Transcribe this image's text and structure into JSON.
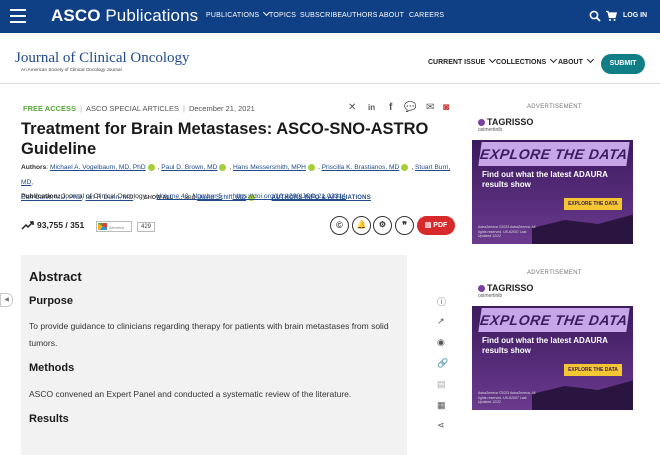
{
  "topbar": {
    "brand_bold": "ASCO",
    "brand_rest": " Publications",
    "nav": [
      "PUBLICATIONS",
      "TOPICS",
      "SUBSCRIBE",
      "AUTHORS",
      "ABOUT",
      "CAREERS"
    ],
    "login": "LOG IN"
  },
  "journal": {
    "title": "Journal of Clinical Oncology",
    "subtitle": "An American Society of Clinical Oncology Journal",
    "nav": [
      "CURRENT ISSUE",
      "COLLECTIONS",
      "ABOUT"
    ],
    "submit": "SUBMIT"
  },
  "article": {
    "access": "FREE ACCESS",
    "section": "ASCO SPECIAL ARTICLES",
    "date": "December 21, 2021",
    "title": "Treatment for Brain Metastases: ASCO-SNO-ASTRO Guideline",
    "authors_label": "Authors",
    "authors": [
      "Michael A. Vogelbaum, MD, PhD",
      "Paul D. Brown, MD",
      "Hans Messersmith, MPH",
      "Priscilla K. Brastianos, MD",
      "Stuart Burri, MD",
      "Dan Cahill, MD, PhD",
      "Ian F. Dunn, MD"
    ],
    "show_all": "SHOW ALL",
    "and_more": "..., and",
    "last_author": "David Schiff, MD",
    "affiliations": "AUTHORS INFO & AFFILIATIONS",
    "publication_label": "Publication:",
    "journal_name": "Journal of Clinical Oncology",
    "volume": "Volume 40, Number 5",
    "doi": "https://doi.org/10.1200/JCO.21.02314",
    "metrics": "93,755 / 351",
    "altmetric_label": "Altmetric",
    "altmetric_score": "429",
    "pdf": "PDF"
  },
  "abstract": {
    "heading": "Abstract",
    "purpose_heading": "Purpose",
    "purpose_text": "To provide guidance to clinicians regarding therapy for patients with brain metastases from solid tumors.",
    "methods_heading": "Methods",
    "methods_text": "ASCO convened an Expert Panel and conducted a systematic review of the literature.",
    "results_heading": "Results"
  },
  "ads": {
    "label": "ADVERTISEMENT",
    "brand": "TAGRISSO",
    "brand_sub": "osimertinib",
    "headline": "EXPLORE THE DATA",
    "find": "Find out what the latest ADAURA results show",
    "cta": "EXPLORE THE DATA",
    "fine": "AstraZeneca ©2023 AstraZeneca. All rights reserved. US-62007 Last Updated 12/22"
  }
}
